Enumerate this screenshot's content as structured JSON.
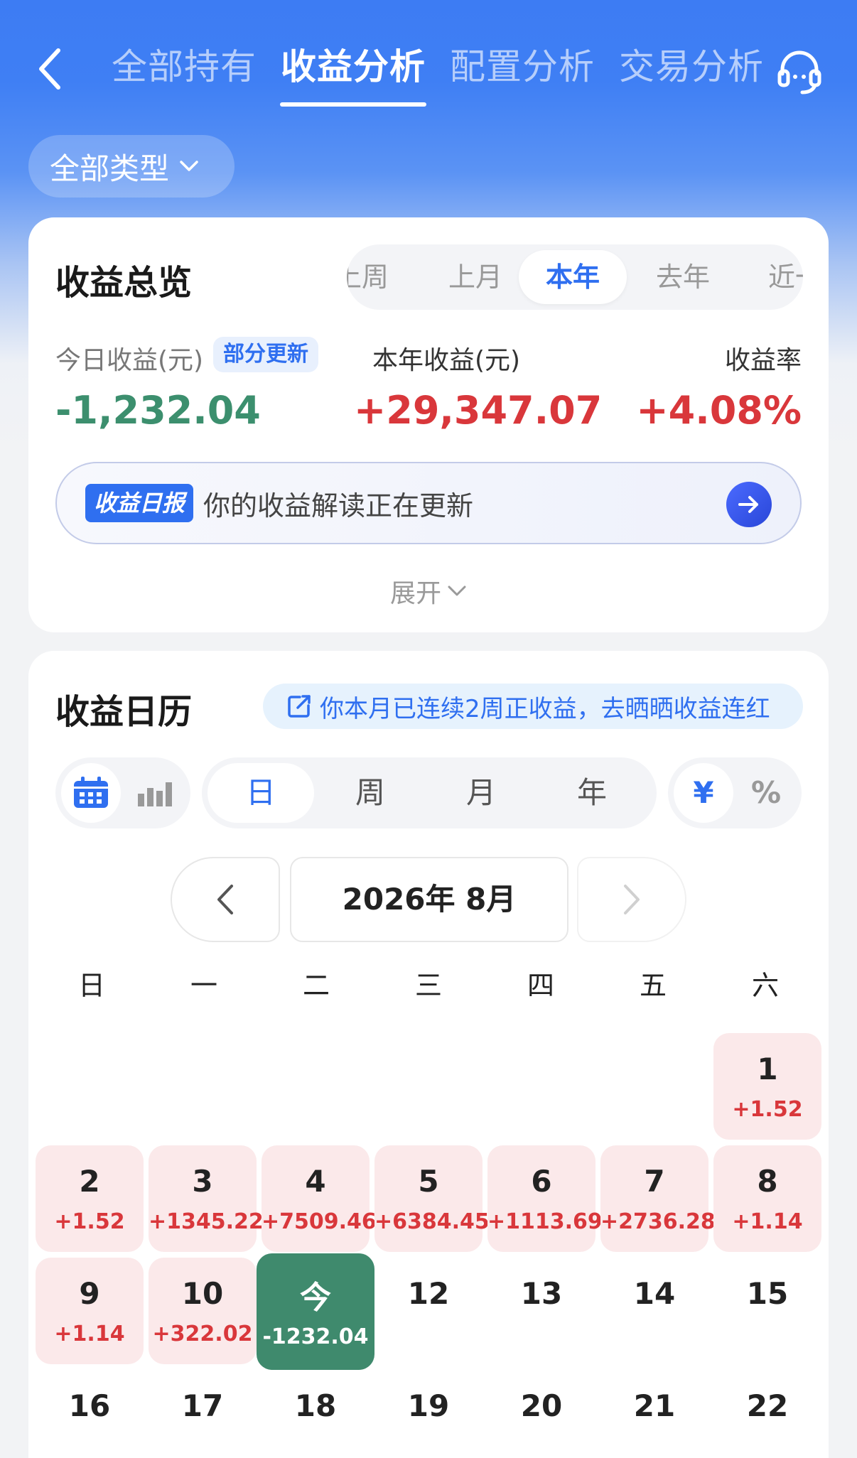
{
  "header": {
    "tabs": [
      {
        "label": "全部持有"
      },
      {
        "label": "收益分析"
      },
      {
        "label": "配置分析"
      },
      {
        "label": "交易分析"
      }
    ]
  },
  "filter": {
    "type_label": "全部类型"
  },
  "overview": {
    "title": "收益总览",
    "periods": [
      {
        "label": "上周"
      },
      {
        "label": "上月"
      },
      {
        "label": "本年"
      },
      {
        "label": "去年"
      },
      {
        "label": "近一"
      }
    ],
    "today_label": "今日收益(元)",
    "partial_badge": "部分更新",
    "today_value": "-1,232.04",
    "year_label": "本年收益(元)",
    "year_value": "+29,347.07",
    "rate_label": "收益率",
    "rate_value": "+4.08%",
    "report_badge": "收益日报",
    "report_text": "你的收益解读正在更新",
    "expand_label": "展开"
  },
  "calendar": {
    "title": "收益日历",
    "share_text": "你本月已连续2周正收益，去晒晒收益连红",
    "granularity": [
      {
        "label": "日"
      },
      {
        "label": "周"
      },
      {
        "label": "月"
      },
      {
        "label": "年"
      }
    ],
    "units": [
      {
        "label": "¥"
      },
      {
        "label": "%"
      }
    ],
    "month_label": "2026年 8月",
    "weekdays": [
      "日",
      "一",
      "二",
      "三",
      "四",
      "五",
      "六"
    ],
    "days": [
      {
        "num": "1",
        "val": "+1.52"
      },
      {
        "num": "2",
        "val": "+1.52"
      },
      {
        "num": "3",
        "val": "+1345.22"
      },
      {
        "num": "4",
        "val": "+7509.46"
      },
      {
        "num": "5",
        "val": "+6384.45"
      },
      {
        "num": "6",
        "val": "+1113.69"
      },
      {
        "num": "7",
        "val": "+2736.28"
      },
      {
        "num": "8",
        "val": "+1.14"
      },
      {
        "num": "9",
        "val": "+1.14"
      },
      {
        "num": "10",
        "val": "+322.02"
      },
      {
        "num": "今",
        "val": "-1232.04"
      },
      {
        "num": "12",
        "val": ""
      },
      {
        "num": "13",
        "val": ""
      },
      {
        "num": "14",
        "val": ""
      },
      {
        "num": "15",
        "val": ""
      },
      {
        "num": "16",
        "val": ""
      },
      {
        "num": "17",
        "val": ""
      },
      {
        "num": "18",
        "val": ""
      },
      {
        "num": "19",
        "val": ""
      },
      {
        "num": "20",
        "val": ""
      },
      {
        "num": "21",
        "val": ""
      },
      {
        "num": "22",
        "val": ""
      }
    ]
  },
  "colors": {
    "accent": "#2f6ff0",
    "positive": "#d9373b",
    "negative": "#3c8f6e",
    "header_blue": "#3d7cf3"
  }
}
